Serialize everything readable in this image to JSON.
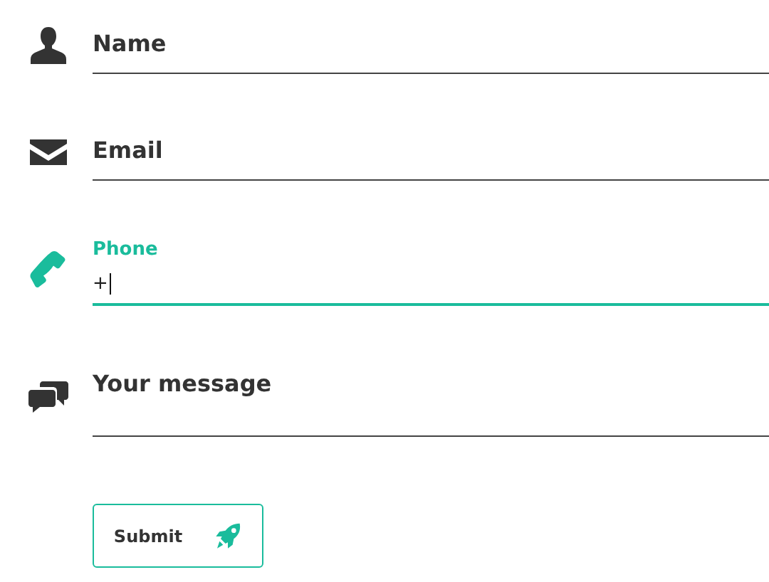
{
  "fields": [
    {
      "kind": "text",
      "label": "Name",
      "focused": false
    },
    {
      "kind": "text",
      "label": "Email",
      "focused": false
    },
    {
      "kind": "text",
      "label": "Phone",
      "focused": true,
      "value": "+"
    },
    {
      "kind": "textarea",
      "label": "Your message",
      "focused": false
    }
  ],
  "submit": {
    "label": "Submit"
  }
}
